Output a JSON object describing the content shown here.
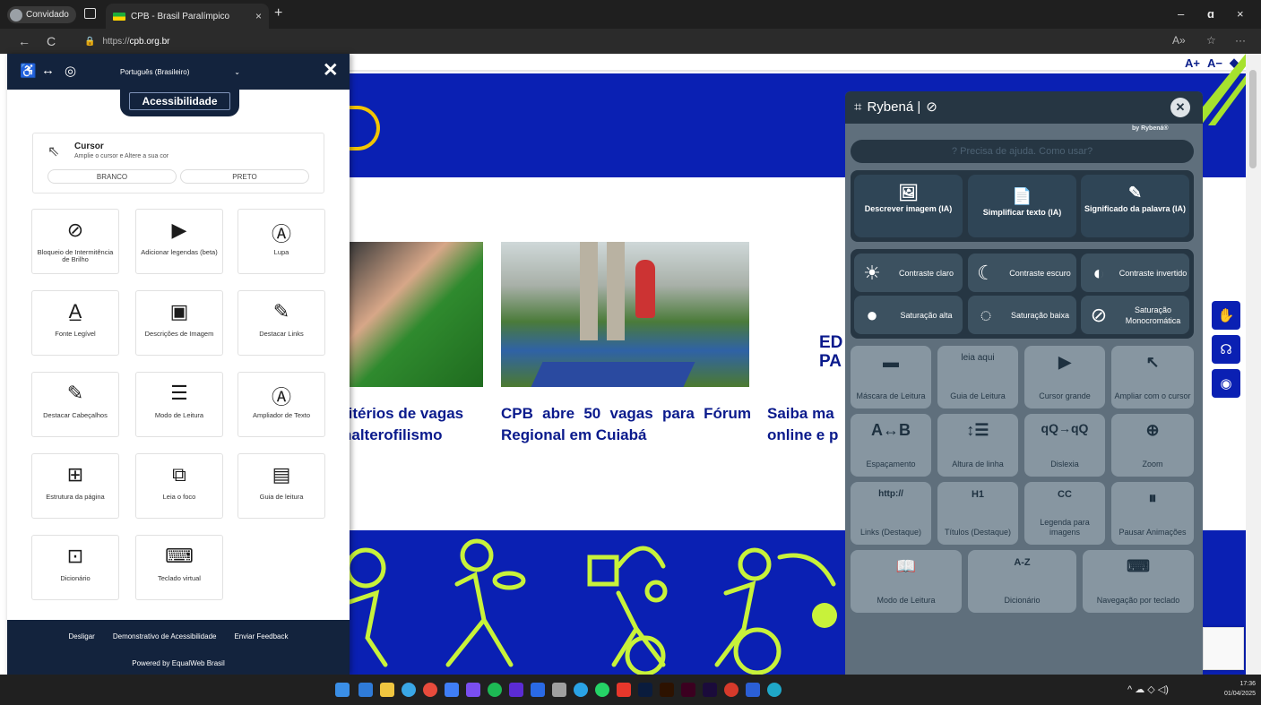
{
  "browser": {
    "profile_label": "Convidado",
    "tab_title": "CPB - Brasil Paralímpico",
    "tab_close": "×",
    "new_tab": "+",
    "url_scheme": "https://",
    "url_host": "cpb.org.br",
    "win_minimize": "–",
    "win_close": "×",
    "win_restore": "ɑ",
    "back": "←",
    "reload": "C"
  },
  "site": {
    "a11y_tools": [
      "A+",
      "A−",
      "◆",
      "▤"
    ],
    "headlines": [
      "ritérios de vagas halterofilismo",
      "CPB abre 50 vagas para Fórum Regional em Cuiabá",
      "Saiba ma online e p"
    ],
    "side_text": [
      "ED",
      "PA"
    ]
  },
  "equalweb": {
    "language": "Português (Brasileiro)",
    "close": "✕",
    "title": "Acessibilidade",
    "cursor": {
      "title": "Cursor",
      "subtitle": "Amplie o cursor e Altere a sua cor",
      "white": "BRANCO",
      "black": "PRETO"
    },
    "tiles": [
      {
        "icon": "⊘",
        "label": "Bloqueio de Intermitência de Brilho"
      },
      {
        "icon": "▶",
        "label": "Adicionar legendas (beta)"
      },
      {
        "icon": "Ⓐ",
        "label": "Lupa"
      },
      {
        "icon": "A̲",
        "label": "Fonte Legível"
      },
      {
        "icon": "▣",
        "label": "Descrições de Imagem"
      },
      {
        "icon": "✎",
        "label": "Destacar Links"
      },
      {
        "icon": "✎",
        "label": "Destacar Cabeçalhos"
      },
      {
        "icon": "☰",
        "label": "Modo de Leitura"
      },
      {
        "icon": "Ⓐ",
        "label": "Ampliador de Texto"
      },
      {
        "icon": "⊞",
        "label": "Estrutura da página"
      },
      {
        "icon": "⧉",
        "label": "Leia o foco"
      },
      {
        "icon": "▤",
        "label": "Guia de leitura"
      },
      {
        "icon": "⊡",
        "label": "Dicionário"
      },
      {
        "icon": "⌨",
        "label": "Teclado virtual"
      }
    ],
    "footer": {
      "links": [
        "Desligar",
        "Demonstrativo de Acessibilidade",
        "Enviar Feedback"
      ],
      "powered": "Powered by EqualWeb Brasil"
    }
  },
  "rybena": {
    "title": "Rybená |",
    "by": "by Rybená®",
    "help": "Precisa de ajuda. Como usar?",
    "ai_buttons": [
      {
        "icon": "🖼",
        "label": "Descrever imagem (IA)"
      },
      {
        "icon": "📄",
        "label": "Simplificar texto (IA)"
      },
      {
        "icon": "✎",
        "label": "Significado da palavra (IA)"
      }
    ],
    "contrast_buttons": [
      {
        "icon": "☀",
        "label": "Contraste claro"
      },
      {
        "icon": "☾",
        "label": "Contraste escuro"
      },
      {
        "icon": "◐",
        "label": "Contraste invertido"
      },
      {
        "icon": "●",
        "label": "Saturação alta"
      },
      {
        "icon": "◌",
        "label": "Saturação baixa"
      },
      {
        "icon": "⊘",
        "label": "Saturação Monocromática"
      }
    ],
    "tools": [
      {
        "icon": "▬",
        "label": "Máscara de Leitura"
      },
      {
        "icon": "leia aqui",
        "label": "Guia de Leitura"
      },
      {
        "icon": "▶",
        "label": "Cursor grande"
      },
      {
        "icon": "↖",
        "label": "Ampliar com o cursor"
      },
      {
        "icon": "A↔B",
        "label": "Espaçamento"
      },
      {
        "icon": "↕☰",
        "label": "Altura de linha"
      },
      {
        "icon": "qQ→qQ",
        "label": "Dislexia"
      },
      {
        "icon": "⊕",
        "label": "Zoom"
      },
      {
        "icon": "http://",
        "label": "Links (Destaque)"
      },
      {
        "icon": "H1",
        "label": "Títulos (Destaque)"
      },
      {
        "icon": "CC",
        "label": "Legenda para imagens"
      },
      {
        "icon": "⏸",
        "label": "Pausar Animações"
      },
      {
        "icon": "📖",
        "label": "Modo de Leitura"
      },
      {
        "icon": "A-Z",
        "label": "Dicionário"
      },
      {
        "icon": "⌨",
        "label": "Navegação por teclado"
      }
    ]
  },
  "taskbar": {
    "time": "17:36",
    "date": "01/04/2025",
    "tray": "^  ☁  ◇ ◁)"
  }
}
